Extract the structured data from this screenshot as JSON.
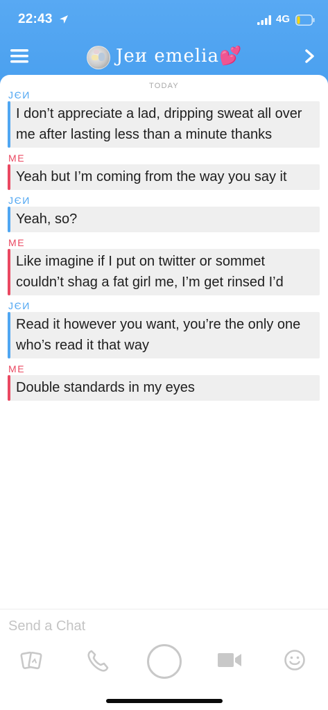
{
  "status_bar": {
    "time": "22:43",
    "network": "4G"
  },
  "header": {
    "contact_name": "Jeи emelia💕"
  },
  "chat": {
    "date_separator": "TODAY",
    "messages": [
      {
        "sender": "JЄИ",
        "from": "them",
        "text": "I don’t appreciate a lad, dripping sweat all over me after lasting less than a minute thanks"
      },
      {
        "sender": "ME",
        "from": "me",
        "text": "Yeah but I’m coming from the way you say it"
      },
      {
        "sender": "JЄИ",
        "from": "them",
        "text": "Yeah, so?"
      },
      {
        "sender": "ME",
        "from": "me",
        "text": "Like imagine if I put on twitter or sommet couldn’t shag a fat girl me, I’m get rinsed I’d"
      },
      {
        "sender": "JЄИ",
        "from": "them",
        "text": "Read it however you want, you’re the only one who’s read it that way"
      },
      {
        "sender": "ME",
        "from": "me",
        "text": "Double standards in my eyes"
      }
    ]
  },
  "input": {
    "placeholder": "Send a Chat",
    "value": ""
  },
  "toolbar": {
    "items": [
      "memories-icon",
      "phone-icon",
      "capture-button",
      "video-icon",
      "emoji-icon"
    ]
  },
  "colors": {
    "header_blue": "#4fa6f2",
    "them_accent": "#4fa6f2",
    "me_accent": "#ea4861",
    "bubble_bg": "#efefef",
    "icon_gray": "#c8c8c8"
  }
}
